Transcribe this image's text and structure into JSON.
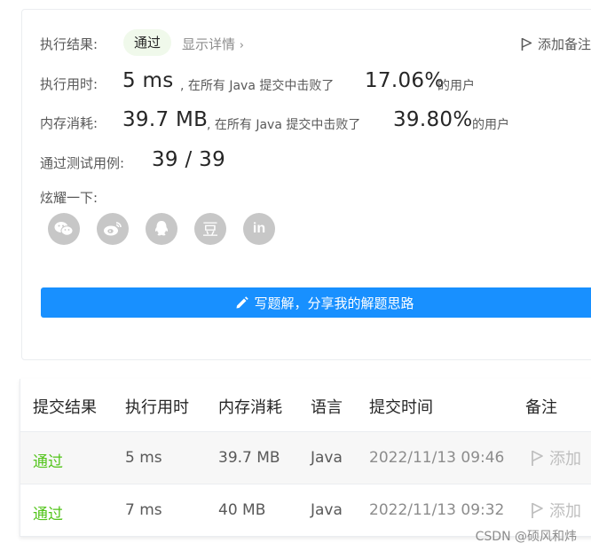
{
  "result": {
    "label": "执行结果:",
    "status": "通过",
    "detail_link": "显示详情",
    "add_note": "添加备注"
  },
  "runtime": {
    "label": "执行用时:",
    "value": "5 ms",
    "text_mid": ", 在所有 Java 提交中击败了",
    "percent": "17.06%",
    "text_end": "的用户"
  },
  "memory": {
    "label": "内存消耗:",
    "value": "39.7 MB",
    "text_mid": ", 在所有 Java 提交中击败了",
    "percent": "39.80%",
    "text_end": "的用户"
  },
  "testcases": {
    "label": "通过测试用例:",
    "value": "39 / 39"
  },
  "share": {
    "label": "炫耀一下:",
    "icons": [
      "wechat-icon",
      "weibo-icon",
      "qq-icon",
      "douban-icon",
      "linkedin-icon"
    ],
    "douban_glyph": "豆",
    "linkedin_glyph": "in",
    "write_solution": "写题解，分享我的解题思路"
  },
  "table": {
    "headers": [
      "提交结果",
      "执行用时",
      "内存消耗",
      "语言",
      "提交时间",
      "备注"
    ],
    "rows": [
      {
        "status": "通过",
        "runtime": "5 ms",
        "memory": "39.7 MB",
        "lang": "Java",
        "time": "2022/11/13 09:46",
        "note": "添加"
      },
      {
        "status": "通过",
        "runtime": "7 ms",
        "memory": "40 MB",
        "lang": "Java",
        "time": "2022/11/13 09:32",
        "note": "添加"
      }
    ]
  },
  "watermark": "CSDN @硕风和炜",
  "colors": {
    "accent": "#1890ff",
    "success": "#52c41a",
    "pill_bg": "#f0f9eb",
    "icon_gray": "#c7c7c7"
  }
}
